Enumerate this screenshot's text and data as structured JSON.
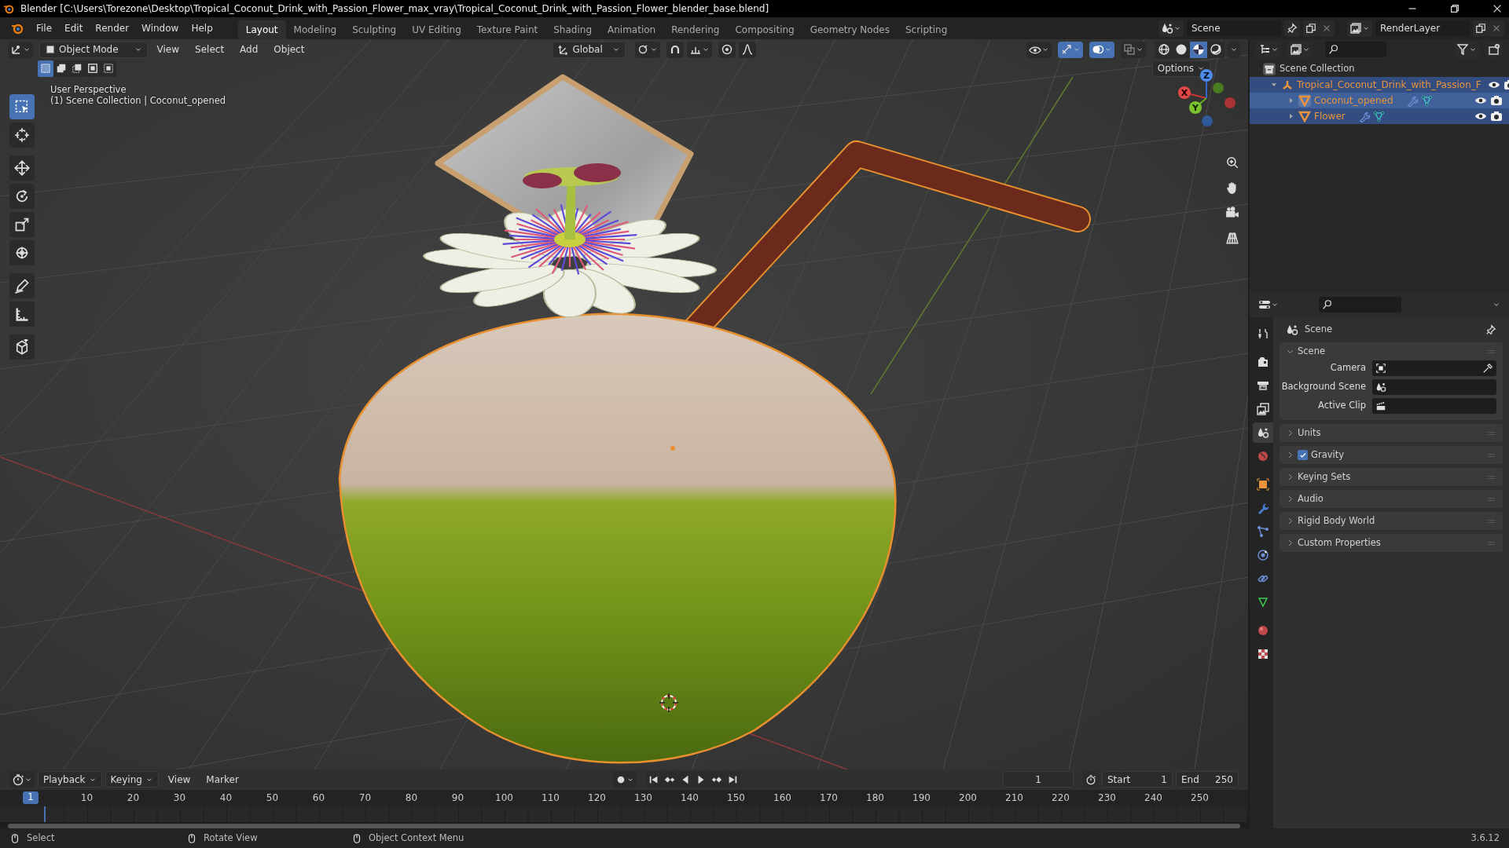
{
  "window": {
    "title": "Blender [C:\\Users\\Torezone\\Desktop\\Tropical_Coconut_Drink_with_Passion_Flower_max_vray\\Tropical_Coconut_Drink_with_Passion_Flower_blender_base.blend]"
  },
  "menu": [
    "File",
    "Edit",
    "Render",
    "Window",
    "Help"
  ],
  "workspaces": [
    {
      "label": "Layout",
      "selected": true
    },
    {
      "label": "Modeling",
      "selected": false
    },
    {
      "label": "Sculpting",
      "selected": false
    },
    {
      "label": "UV Editing",
      "selected": false
    },
    {
      "label": "Texture Paint",
      "selected": false
    },
    {
      "label": "Shading",
      "selected": false
    },
    {
      "label": "Animation",
      "selected": false
    },
    {
      "label": "Rendering",
      "selected": false
    },
    {
      "label": "Compositing",
      "selected": false
    },
    {
      "label": "Geometry Nodes",
      "selected": false
    },
    {
      "label": "Scripting",
      "selected": false
    }
  ],
  "scene_selector": {
    "value": "Scene"
  },
  "view_layer_selector": {
    "value": "RenderLayer"
  },
  "viewport": {
    "mode": "Object Mode",
    "menus": [
      "View",
      "Select",
      "Add",
      "Object"
    ],
    "orientation": "Global",
    "options": "Options",
    "select_modes": [
      {
        "kind": "set",
        "selected": true
      },
      {
        "kind": "extend",
        "selected": false
      },
      {
        "kind": "subtract",
        "selected": false
      },
      {
        "kind": "invert",
        "selected": false
      },
      {
        "kind": "intersect",
        "selected": false
      }
    ],
    "overlay_text": [
      "User Perspective",
      "(1) Scene Collection | Coconut_opened"
    ],
    "toggles": [
      {
        "kind": "visibility",
        "on": false
      },
      {
        "kind": "gizmos",
        "on": true
      },
      {
        "kind": "overlays",
        "on": true
      },
      {
        "kind": "xray",
        "on": false
      }
    ],
    "shading": [
      {
        "kind": "wireframe",
        "selected": false
      },
      {
        "kind": "solid",
        "selected": false
      },
      {
        "kind": "material",
        "selected": true
      },
      {
        "kind": "rendered",
        "selected": false
      }
    ],
    "tools": [
      {
        "kind": "select",
        "selected": true
      },
      {
        "kind": "cursor",
        "selected": false
      },
      {
        "kind": "move",
        "selected": false
      },
      {
        "kind": "rotate",
        "selected": false
      },
      {
        "kind": "scale",
        "selected": false
      },
      {
        "kind": "transform",
        "selected": false
      },
      {
        "kind": "annotate",
        "selected": false
      },
      {
        "kind": "measure",
        "selected": false
      },
      {
        "kind": "add-cube",
        "selected": false
      }
    ],
    "gizmo_axes": [
      "X",
      "Y",
      "Z"
    ]
  },
  "outliner": {
    "root": "Scene Collection",
    "items": [
      {
        "label": "Tropical_Coconut_Drink_with_Passion_F",
        "kind": "empty",
        "expanded": true,
        "selected": true,
        "active": false,
        "modifiers": false,
        "mesh_data": false,
        "children": [
          {
            "label": "Coconut_opened",
            "kind": "mesh",
            "expanded": false,
            "selected": true,
            "active": true,
            "modifiers": true,
            "mesh_data": true
          },
          {
            "label": "Flower",
            "kind": "mesh",
            "expanded": false,
            "selected": true,
            "active": false,
            "modifiers": true,
            "mesh_data": true
          }
        ]
      }
    ]
  },
  "properties": {
    "tabs": [
      {
        "kind": "tool",
        "selected": false
      },
      {
        "kind": "render",
        "selected": false
      },
      {
        "kind": "output",
        "selected": false
      },
      {
        "kind": "view-layer",
        "selected": false
      },
      {
        "kind": "scene",
        "selected": true
      },
      {
        "kind": "world",
        "selected": false
      },
      {
        "kind": "object",
        "selected": false
      },
      {
        "kind": "modifiers",
        "selected": false
      },
      {
        "kind": "particles",
        "selected": false
      },
      {
        "kind": "physics",
        "selected": false
      },
      {
        "kind": "constraints",
        "selected": false
      },
      {
        "kind": "data",
        "selected": false
      },
      {
        "kind": "material",
        "selected": false
      },
      {
        "kind": "texture",
        "selected": false
      }
    ],
    "header": "Scene",
    "panels": [
      {
        "title": "Scene",
        "kind": "section",
        "expanded": true,
        "fields": [
          {
            "label": "Camera",
            "kind": "camera"
          },
          {
            "label": "Background Scene",
            "kind": "scene"
          },
          {
            "label": "Active Clip",
            "kind": "clip"
          }
        ]
      },
      {
        "title": "Units",
        "kind": "section",
        "expanded": false
      },
      {
        "title": "Gravity",
        "kind": "toggle",
        "expanded": false,
        "checked": true
      },
      {
        "title": "Keying Sets",
        "kind": "section",
        "expanded": false
      },
      {
        "title": "Audio",
        "kind": "section",
        "expanded": false
      },
      {
        "title": "Rigid Body World",
        "kind": "section",
        "expanded": false
      },
      {
        "title": "Custom Properties",
        "kind": "section",
        "expanded": false
      }
    ]
  },
  "timeline": {
    "menus": [
      "Playback",
      "Keying",
      "View",
      "Marker"
    ],
    "current_frame": "1",
    "start_label": "Start",
    "start": "1",
    "end_label": "End",
    "end": "250",
    "playhead": "1",
    "ticks": [
      "10",
      "20",
      "30",
      "40",
      "50",
      "60",
      "70",
      "80",
      "90",
      "100",
      "110",
      "120",
      "130",
      "140",
      "150",
      "160",
      "170",
      "180",
      "190",
      "200",
      "210",
      "220",
      "230",
      "240",
      "250"
    ]
  },
  "status_bar": {
    "hints": [
      {
        "label": "Select",
        "kind": "left"
      },
      {
        "label": "Rotate View",
        "kind": "middle"
      },
      {
        "label": "Object Context Menu",
        "kind": "right"
      }
    ],
    "version": "3.6.12"
  }
}
